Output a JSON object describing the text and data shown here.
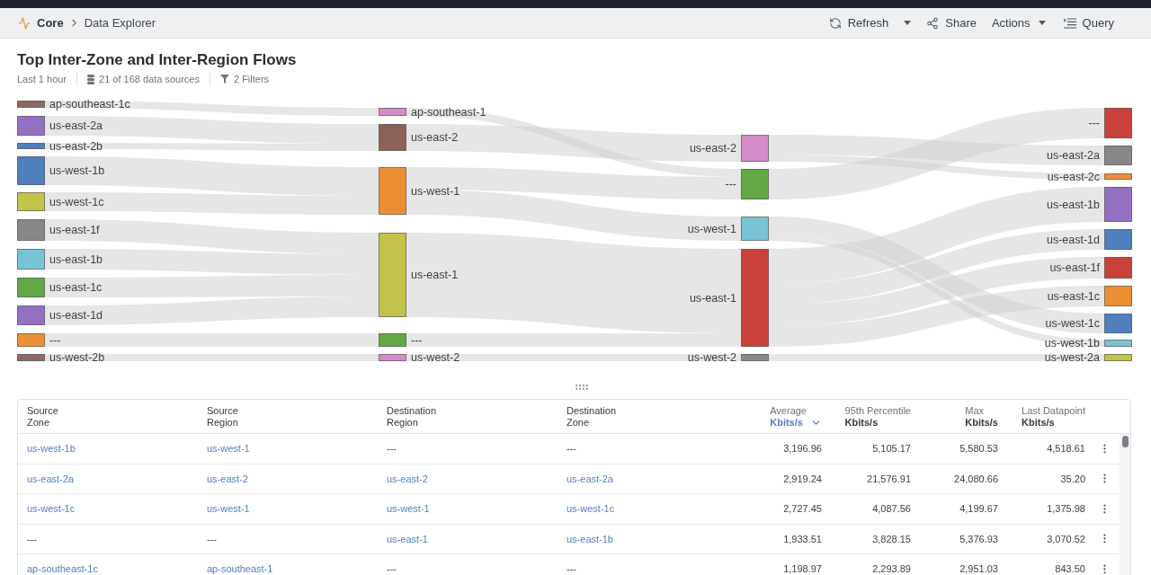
{
  "breadcrumb": {
    "app": "Core",
    "page": "Data Explorer"
  },
  "toolbar": {
    "refresh": {
      "label": "Refresh"
    },
    "share": {
      "label": "Share"
    },
    "actions": {
      "label": "Actions"
    },
    "query": {
      "label": "Query"
    }
  },
  "title": "Top Inter-Zone and Inter-Region Flows",
  "meta": {
    "time_range": "Last 1 hour",
    "data_sources": "21 of 168 data sources",
    "filters": "2 Filters"
  },
  "sankey": {
    "columns": [
      {
        "nodes": [
          {
            "label": "ap-southeast-1c",
            "color": "#8c6a5f"
          },
          {
            "label": "us-east-2a",
            "color": "#9470c3"
          },
          {
            "label": "us-east-2b",
            "color": "#4f7fbd"
          },
          {
            "label": "us-west-1b",
            "color": "#4f7fbd"
          },
          {
            "label": "us-west-1c",
            "color": "#c3c24a"
          },
          {
            "label": "us-east-1f",
            "color": "#878787"
          },
          {
            "label": "us-east-1b",
            "color": "#78c3d4"
          },
          {
            "label": "us-east-1c",
            "color": "#63a845"
          },
          {
            "label": "us-east-1d",
            "color": "#9470c3"
          },
          {
            "label": "---",
            "color": "#ec8f34"
          },
          {
            "label": "us-west-2b",
            "color": "#8c6a5f"
          }
        ]
      },
      {
        "nodes": [
          {
            "label": "ap-southeast-1",
            "color": "#d48bc8"
          },
          {
            "label": "us-east-2",
            "color": "#8c6258"
          },
          {
            "label": "us-west-1",
            "color": "#ec8f34"
          },
          {
            "label": "us-east-1",
            "color": "#c3c24a"
          },
          {
            "label": "---",
            "color": "#63a845"
          },
          {
            "label": "us-west-2",
            "color": "#d48bc8"
          }
        ]
      },
      {
        "nodes": [
          {
            "label": "us-east-2",
            "color": "#d48bc8"
          },
          {
            "label": "---",
            "color": "#63a845"
          },
          {
            "label": "us-west-1",
            "color": "#78c3d4"
          },
          {
            "label": "us-east-1",
            "color": "#c8413a"
          },
          {
            "label": "us-west-2",
            "color": "#878787"
          }
        ]
      },
      {
        "nodes": [
          {
            "label": "---",
            "color": "#c8413a"
          },
          {
            "label": "us-east-2a",
            "color": "#878787"
          },
          {
            "label": "us-east-2c",
            "color": "#ec8f34"
          },
          {
            "label": "us-east-1b",
            "color": "#9470c3"
          },
          {
            "label": "us-east-1d",
            "color": "#4f7fbd"
          },
          {
            "label": "us-east-1f",
            "color": "#c8413a"
          },
          {
            "label": "us-east-1c",
            "color": "#ec8f34"
          },
          {
            "label": "us-west-1c",
            "color": "#4f7fbd"
          },
          {
            "label": "us-west-1b",
            "color": "#78c3d4"
          },
          {
            "label": "us-west-2a",
            "color": "#c3c24a"
          }
        ]
      }
    ]
  },
  "table": {
    "columns": [
      {
        "label": "Source",
        "sublabel": "Zone",
        "kind": "text",
        "sorted": false
      },
      {
        "label": "Source",
        "sublabel": "Region",
        "kind": "text",
        "sorted": false
      },
      {
        "label": "Destination",
        "sublabel": "Region",
        "kind": "text",
        "sorted": false
      },
      {
        "label": "Destination",
        "sublabel": "Zone",
        "kind": "text",
        "sorted": false
      },
      {
        "label": "Average",
        "sublabel": "Kbits/s",
        "kind": "number",
        "sorted": true
      },
      {
        "label": "95th Percentile",
        "sublabel": "Kbits/s",
        "kind": "number",
        "sorted": false
      },
      {
        "label": "Max",
        "sublabel": "Kbits/s",
        "kind": "number",
        "sorted": false
      },
      {
        "label": "Last Datapoint",
        "sublabel": "Kbits/s",
        "kind": "number",
        "sorted": false
      }
    ],
    "rows": [
      {
        "zones": [
          {
            "text": "us-west-1b",
            "link": true
          },
          {
            "text": "us-west-1",
            "link": true
          },
          {
            "text": "---",
            "link": false
          },
          {
            "text": "---",
            "link": false
          }
        ],
        "values": [
          "3,196.96",
          "5,105.17",
          "5,580.53",
          "4,518.61"
        ]
      },
      {
        "zones": [
          {
            "text": "us-east-2a",
            "link": true
          },
          {
            "text": "us-east-2",
            "link": true
          },
          {
            "text": "us-east-2",
            "link": true
          },
          {
            "text": "us-east-2a",
            "link": true
          }
        ],
        "values": [
          "2,919.24",
          "21,576.91",
          "24,080.66",
          "35.20"
        ]
      },
      {
        "zones": [
          {
            "text": "us-west-1c",
            "link": true
          },
          {
            "text": "us-west-1",
            "link": true
          },
          {
            "text": "us-west-1",
            "link": true
          },
          {
            "text": "us-west-1c",
            "link": true
          }
        ],
        "values": [
          "2,727.45",
          "4,087.56",
          "4,199.67",
          "1,375.98"
        ]
      },
      {
        "zones": [
          {
            "text": "---",
            "link": false
          },
          {
            "text": "---",
            "link": false
          },
          {
            "text": "us-east-1",
            "link": true
          },
          {
            "text": "us-east-1b",
            "link": true
          }
        ],
        "values": [
          "1,933.51",
          "3,828.15",
          "5,376.93",
          "3,070.52"
        ]
      },
      {
        "zones": [
          {
            "text": "ap-southeast-1c",
            "link": true
          },
          {
            "text": "ap-southeast-1",
            "link": true
          },
          {
            "text": "---",
            "link": false
          },
          {
            "text": "---",
            "link": false
          }
        ],
        "values": [
          "1,198.97",
          "2,293.89",
          "2,951.03",
          "843.50"
        ]
      }
    ]
  }
}
